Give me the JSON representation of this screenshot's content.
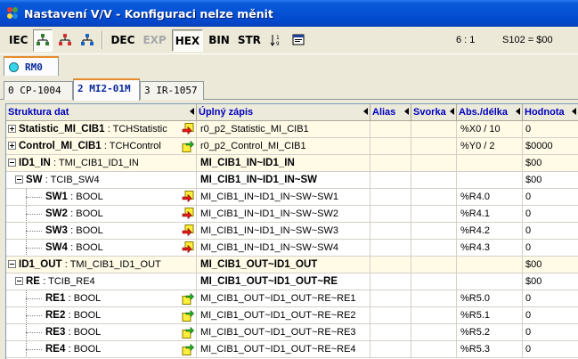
{
  "window": {
    "title": "Nastavení V/V - Konfiguraci nelze měnit"
  },
  "toolbar": {
    "iec": "IEC",
    "dec": "DEC",
    "exp": "EXP",
    "hex": "HEX",
    "bin": "BIN",
    "str": "STR",
    "ratio": "6 : 1",
    "status": "S102 = $00"
  },
  "rm": {
    "label": "RM0"
  },
  "tabs": [
    {
      "label": "0 CP-1004"
    },
    {
      "label": "2 MI2-01M"
    },
    {
      "label": "3 IR-1057"
    }
  ],
  "columns": {
    "structure": "Struktura dat",
    "full": "Úplný zápis",
    "alias": "Alias",
    "terminal": "Svorka",
    "abs": "Abs./délka",
    "value": "Hodnota"
  },
  "rows": [
    {
      "name": "Statistic_MI_CIB1",
      "type": ": TCHStatistic",
      "full": "r0_p2_Statistic_MI_CIB1",
      "abs": "%X0 / 10",
      "value": "0"
    },
    {
      "name": "Control_MI_CIB1",
      "type": ": TCHControl",
      "full": "r0_p2_Control_MI_CIB1",
      "abs": "%Y0 / 2",
      "value": "$0000"
    },
    {
      "name": "ID1_IN",
      "type": ": TMI_CIB1_ID1_IN",
      "full": "MI_CIB1_IN~ID1_IN",
      "abs": "",
      "value": "$00"
    },
    {
      "name": "SW",
      "type": ": TCIB_SW4",
      "full": "MI_CIB1_IN~ID1_IN~SW",
      "abs": "",
      "value": "$00"
    },
    {
      "name": "SW1",
      "type": ": BOOL",
      "full": "MI_CIB1_IN~ID1_IN~SW~SW1",
      "abs": "%R4.0",
      "value": "0"
    },
    {
      "name": "SW2",
      "type": ": BOOL",
      "full": "MI_CIB1_IN~ID1_IN~SW~SW2",
      "abs": "%R4.1",
      "value": "0"
    },
    {
      "name": "SW3",
      "type": ": BOOL",
      "full": "MI_CIB1_IN~ID1_IN~SW~SW3",
      "abs": "%R4.2",
      "value": "0"
    },
    {
      "name": "SW4",
      "type": ": BOOL",
      "full": "MI_CIB1_IN~ID1_IN~SW~SW4",
      "abs": "%R4.3",
      "value": "0"
    },
    {
      "name": "ID1_OUT",
      "type": ": TMI_CIB1_ID1_OUT",
      "full": "MI_CIB1_OUT~ID1_OUT",
      "abs": "",
      "value": "$00"
    },
    {
      "name": "RE",
      "type": ": TCIB_RE4",
      "full": "MI_CIB1_OUT~ID1_OUT~RE",
      "abs": "",
      "value": "$00"
    },
    {
      "name": "RE1",
      "type": ": BOOL",
      "full": "MI_CIB1_OUT~ID1_OUT~RE~RE1",
      "abs": "%R5.0",
      "value": "0"
    },
    {
      "name": "RE2",
      "type": ": BOOL",
      "full": "MI_CIB1_OUT~ID1_OUT~RE~RE2",
      "abs": "%R5.1",
      "value": "0"
    },
    {
      "name": "RE3",
      "type": ": BOOL",
      "full": "MI_CIB1_OUT~ID1_OUT~RE~RE3",
      "abs": "%R5.2",
      "value": "0"
    },
    {
      "name": "RE4",
      "type": ": BOOL",
      "full": "MI_CIB1_OUT~ID1_OUT~RE~RE4",
      "abs": "%R5.3",
      "value": "0"
    }
  ],
  "icons": {
    "input_arrow": "red-arrow-right-icon",
    "output_arrow": "green-arrow-right-icon"
  },
  "colors": {
    "title_bar": "#0552d6",
    "header_text": "#0000c0",
    "active_tab_accent": "#e68b2c",
    "row_highlight": "#fffbe7"
  }
}
